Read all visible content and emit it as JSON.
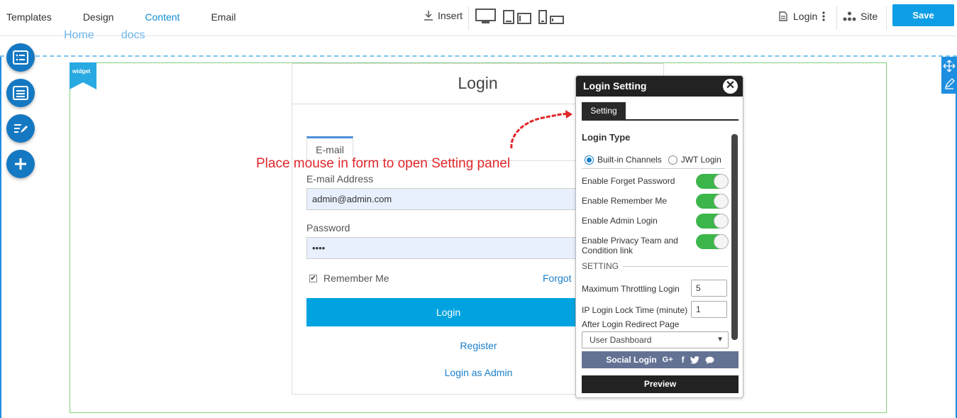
{
  "topbar": {
    "tabs": [
      {
        "label": "Templates",
        "active": false
      },
      {
        "label": "Design",
        "active": false
      },
      {
        "label": "Content",
        "active": true
      },
      {
        "label": "Email",
        "active": false
      }
    ],
    "insert_label": "Insert",
    "login_label": "Login",
    "site_label": "Site",
    "save_label": "Save"
  },
  "breadcrumbs": [
    "Home",
    "docs"
  ],
  "widget_label": "widget",
  "login_form": {
    "title": "Login",
    "tab_label": "E-mail",
    "email_label": "E-mail Address",
    "email_value": "admin@admin.com",
    "password_label": "Password",
    "password_value": "••••",
    "remember_label": "Remember Me",
    "remember_checked": true,
    "forgot_label": "Forgot",
    "login_button": "Login",
    "register_link": "Register",
    "admin_link": "Login as Admin"
  },
  "annotation": "Place mouse in form to open Setting panel",
  "settings_panel": {
    "title": "Login Setting",
    "tab": "Setting",
    "login_type_heading": "Login Type",
    "login_types": [
      {
        "label": "Built-in Channels",
        "selected": true
      },
      {
        "label": "JWT Login",
        "selected": false
      }
    ],
    "toggles": [
      {
        "label": "Enable Forget Password",
        "on": true
      },
      {
        "label": "Enable Remember Me",
        "on": true
      },
      {
        "label": "Enable Admin Login",
        "on": true
      },
      {
        "label": "Enable Privacy Team and Condition link",
        "on": true
      }
    ],
    "setting_heading": "SETTING",
    "max_throttling_label": "Maximum Throttling Login",
    "max_throttling_value": "5",
    "lock_time_label": "IP Login Lock Time (minute)",
    "lock_time_value": "1",
    "redirect_label": "After Login Redirect Page",
    "redirect_value": "User Dashboard",
    "social_login_label": "Social Login",
    "preview_label": "Preview"
  },
  "colors": {
    "accent": "#0e9ee5",
    "toggle_on": "#3cb54a",
    "annotation": "#e0262a",
    "panel_dark": "#222222",
    "social_bar": "#637193"
  }
}
